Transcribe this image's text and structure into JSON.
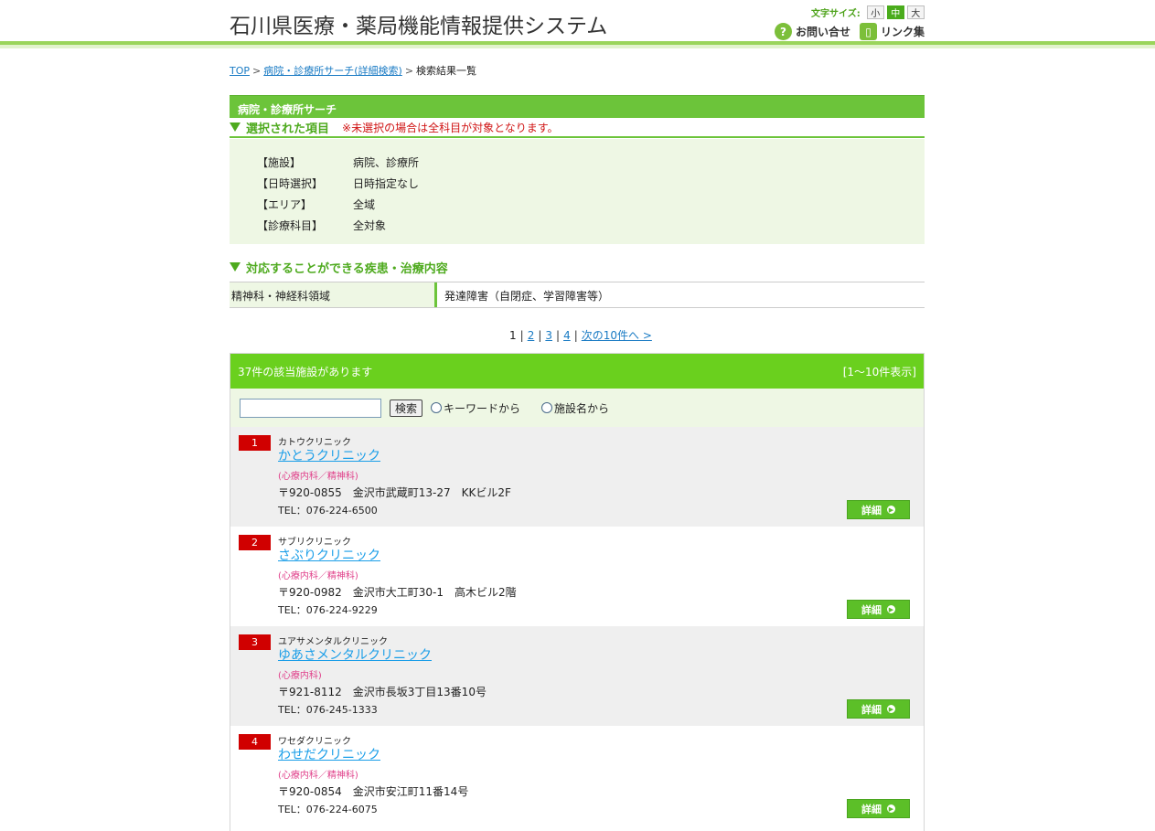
{
  "header": {
    "title": "石川県医療・薬局機能情報提供システム",
    "fontsize_label": "文字サイズ:",
    "fontsize_options": [
      "小",
      "中",
      "大"
    ],
    "fontsize_selected": "中",
    "contact_label": "お問い合せ",
    "links_label": "リンク集"
  },
  "breadcrumb": {
    "top": "TOP",
    "search": "病院・診療所サーチ(詳細検索)",
    "current": "検索結果一覧"
  },
  "panel": {
    "title": "病院・診療所サーチ",
    "selected_title": "選択された項目",
    "selected_note": "※未選択の場合は全科目が対象となります。",
    "rows": [
      {
        "key": "【施設】",
        "value": "病院、診療所"
      },
      {
        "key": "【日時選択】",
        "value": "日時指定なし"
      },
      {
        "key": "【エリア】",
        "value": "全域"
      },
      {
        "key": "【診療科目】",
        "value": "全対象"
      }
    ],
    "disease_title": "対応することができる疾患・治療内容",
    "disease_category": "精神科・神経科領域",
    "disease_value": "発達障害（自閉症、学習障害等）"
  },
  "pager": {
    "current": "1",
    "pages": [
      "2",
      "3",
      "4"
    ],
    "next": "次の10件へ >"
  },
  "results": {
    "count_text": "37件の該当施設があります",
    "range_text": "[1～10件表示]",
    "search_button": "検索",
    "radio_keyword": "キーワードから",
    "radio_name": "施設名から",
    "detail_label": "詳細",
    "items": [
      {
        "no": "1",
        "kana": "カトウクリニック",
        "name": "かとうクリニック",
        "dept": "(心療内科／精神科)",
        "addr": "〒920-0855　金沢市武蔵町13-27　KKビル2F",
        "tel": "TEL：076-224-6500"
      },
      {
        "no": "2",
        "kana": "サブリクリニック",
        "name": "さぶりクリニック",
        "dept": "(心療内科／精神科)",
        "addr": "〒920-0982　金沢市大工町30-1　高木ビル2階",
        "tel": "TEL：076-224-9229"
      },
      {
        "no": "3",
        "kana": "ユアサメンタルクリニック",
        "name": "ゆあさメンタルクリニック",
        "dept": "(心療内科)",
        "addr": "〒921-8112　金沢市長坂3丁目13番10号",
        "tel": "TEL：076-245-1333"
      },
      {
        "no": "4",
        "kana": "ワセダクリニック",
        "name": "わせだクリニック",
        "dept": "(心療内科／精神科)",
        "addr": "〒920-0854　金沢市安江町11番14号",
        "tel": "TEL：076-224-6075"
      }
    ]
  }
}
